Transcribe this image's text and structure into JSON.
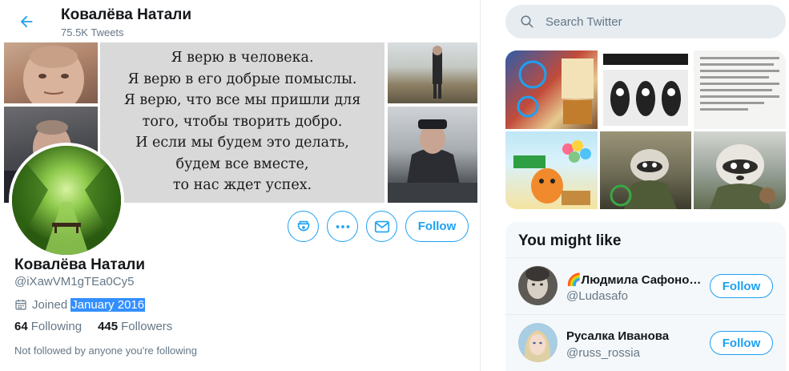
{
  "header": {
    "name": "Ковалёва Натали",
    "tweet_count": "75.5K Tweets"
  },
  "banner": {
    "quote_lines": [
      "Я верю в человека.",
      "Я верю в его добрые помыслы.",
      "Я верю, что все мы пришли для",
      "того, чтобы творить добро.",
      "И если мы будем это делать,",
      "будем все вместе,",
      "то нас ждет успех."
    ]
  },
  "profile": {
    "name": "Ковалёва Натали",
    "handle": "@iXawVM1gTEa0Cy5",
    "joined_prefix": "Joined",
    "joined_date": "January 2016",
    "following_count": "64",
    "following_label": "Following",
    "followers_count": "445",
    "followers_label": "Followers",
    "follow_label": "Follow",
    "not_followed_text": "Not followed by anyone you're following"
  },
  "search": {
    "placeholder": "Search Twitter"
  },
  "you_might_like": {
    "title": "You might like",
    "items": [
      {
        "name": "🌈Людмила Сафоно…",
        "handle": "@Ludasafo",
        "follow_label": "Follow"
      },
      {
        "name": "Русалка Иванова",
        "handle": "@russ_rossia",
        "follow_label": "Follow"
      }
    ]
  },
  "colors": {
    "accent": "#1da1f2",
    "text_primary": "#14171a",
    "text_secondary": "#657786",
    "selection": "#338fff",
    "panel_bg": "#f5f8fa"
  },
  "icons": [
    "back-arrow-icon",
    "tip-jar-icon",
    "more-icon",
    "message-icon",
    "calendar-icon",
    "search-icon"
  ]
}
